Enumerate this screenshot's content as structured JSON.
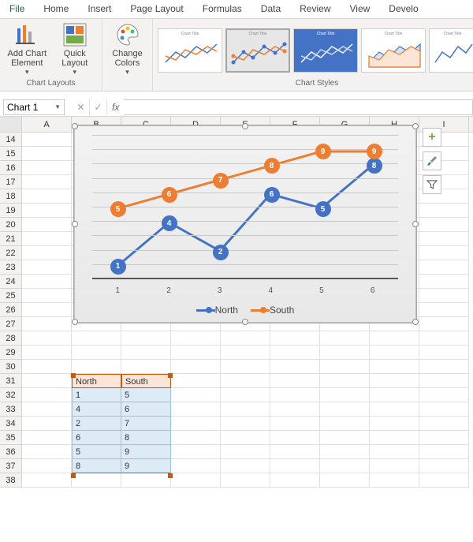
{
  "tabs": [
    "File",
    "Home",
    "Insert",
    "Page Layout",
    "Formulas",
    "Data",
    "Review",
    "View",
    "Develo"
  ],
  "ribbon": {
    "add_chart_element": "Add Chart\nElement",
    "quick_layout": "Quick\nLayout",
    "change_colors": "Change\nColors",
    "group_layouts": "Chart Layouts",
    "group_styles": "Chart Styles",
    "thumb_title": "Chart Title"
  },
  "namebox": "Chart 1",
  "fx": "fx",
  "cols": [
    "A",
    "B",
    "C",
    "D",
    "E",
    "F",
    "G",
    "H",
    "I"
  ],
  "rows": [
    "14",
    "15",
    "16",
    "17",
    "18",
    "19",
    "20",
    "21",
    "22",
    "23",
    "24",
    "25",
    "26",
    "27",
    "28",
    "29",
    "30",
    "31",
    "32",
    "33",
    "34",
    "35",
    "36",
    "37",
    "38"
  ],
  "table": {
    "headers": [
      "North",
      "South"
    ],
    "rows": [
      [
        "1",
        "5"
      ],
      [
        "4",
        "6"
      ],
      [
        "2",
        "7"
      ],
      [
        "6",
        "8"
      ],
      [
        "5",
        "9"
      ],
      [
        "8",
        "9"
      ]
    ]
  },
  "chart_data": {
    "type": "line",
    "categories": [
      "1",
      "2",
      "3",
      "4",
      "5",
      "6"
    ],
    "series": [
      {
        "name": "North",
        "values": [
          1,
          4,
          2,
          6,
          5,
          8
        ],
        "color": "#4472c4"
      },
      {
        "name": "South",
        "values": [
          5,
          6,
          7,
          8,
          9,
          9
        ],
        "color": "#ed7d31"
      }
    ],
    "ylim": [
      0,
      10
    ],
    "gridlines": 10,
    "xlabel": "",
    "ylabel": "",
    "title": ""
  },
  "side_icons": [
    "plus-icon",
    "brush-icon",
    "filter-icon"
  ]
}
